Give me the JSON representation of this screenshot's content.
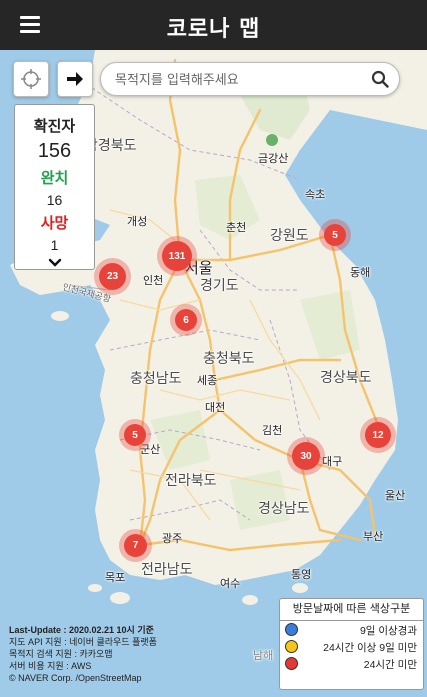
{
  "header": {
    "title": "코로나 맵",
    "menu_icon": "hamburger-icon"
  },
  "toolbar": {
    "locate_icon": "crosshair-icon",
    "route_icon": "arrow-right-icon"
  },
  "search": {
    "placeholder": "목적지를 입력해주세요",
    "icon": "search-icon"
  },
  "stats": {
    "confirmed_label": "확진자",
    "confirmed_value": "156",
    "recovered_label": "완치",
    "recovered_value": "16",
    "deaths_label": "사망",
    "deaths_value": "1",
    "expand_icon": "chevron-down-icon",
    "colors": {
      "recovered": "#1aa34a",
      "deaths": "#e02020"
    }
  },
  "clusters": [
    {
      "label": "131"
    },
    {
      "label": "23"
    },
    {
      "label": "6"
    },
    {
      "label": "5"
    },
    {
      "label": "5"
    },
    {
      "label": "30"
    },
    {
      "label": "12"
    },
    {
      "label": "7"
    }
  ],
  "map_labels": {
    "hambuk": "함경북도",
    "geumgang": "금강산",
    "sokcho": "속초",
    "gaeseong": "개성",
    "chuncheon": "춘천",
    "gangwon": "강원도",
    "seoul": "서울",
    "incheon": "인천",
    "gyeonggi": "경기도",
    "donghae": "동해",
    "airport": "인천국제공항",
    "chungbuk": "충청북도",
    "chungnam": "충청남도",
    "sejong": "세종",
    "daejeon": "대전",
    "gyeongbuk": "경상북도",
    "gimcheon": "김천",
    "gunsan": "군산",
    "daegu": "대구",
    "jeonbuk": "전라북도",
    "ulsan": "울산",
    "gyeongnam": "경상남도",
    "busan": "부산",
    "gwangju": "광주",
    "mokpo": "목포",
    "jeonnam": "전라남도",
    "yeosu": "여수",
    "tongyeong": "통영",
    "namhae": "남해"
  },
  "credits": {
    "last_update": "Last-Update : 2020.02.21 10시 기준",
    "map_api": "지도 API 지원 : 네이버 클라우드 플랫폼",
    "search_api": "목적지 검색 지원 : 카카오맵",
    "server": "서버 비용 지원 : AWS",
    "copyright": "© NAVER Corp. /OpenStreetMap"
  },
  "legend": {
    "title": "방문날짜에 따른 색상구분",
    "items": [
      {
        "label": "9일 이상경과",
        "color": "#3b7ddd"
      },
      {
        "label": "24시간 이상 9일 미만",
        "color": "#f5c518"
      },
      {
        "label": "24시간 미만",
        "color": "#e53935"
      }
    ]
  }
}
